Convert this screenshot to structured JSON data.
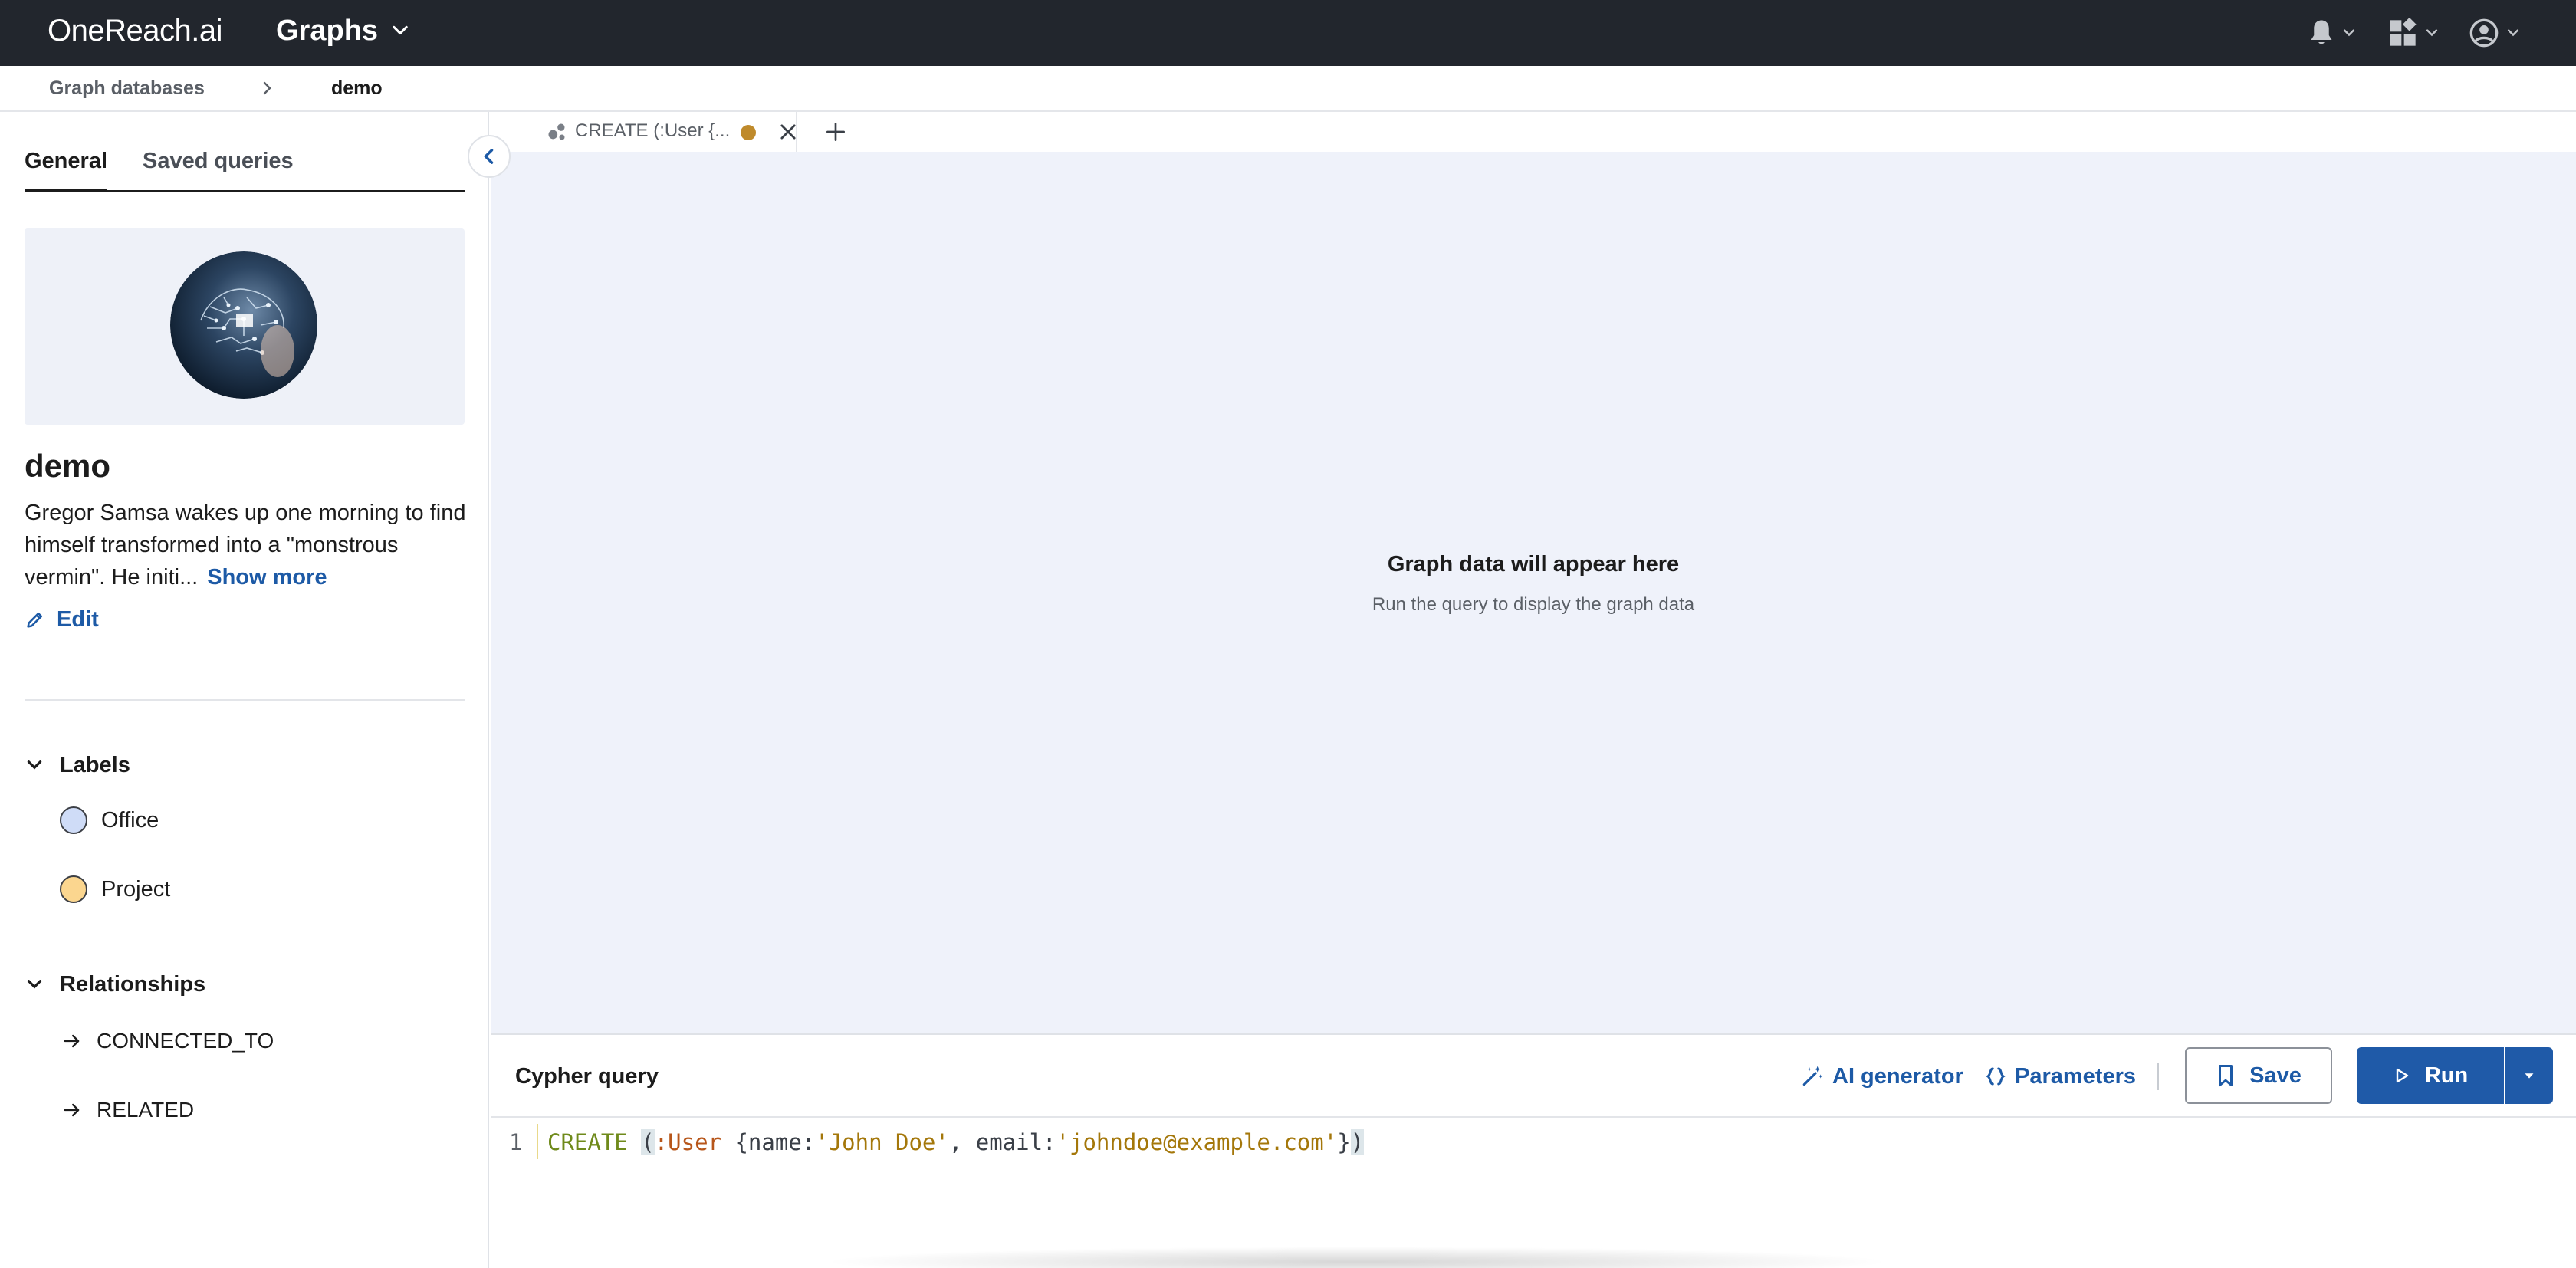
{
  "topbar": {
    "logo": "OneReach.ai",
    "app_title": "Graphs"
  },
  "breadcrumb": {
    "root": "Graph databases",
    "current": "demo"
  },
  "sidebar": {
    "tabs": [
      "General",
      "Saved queries"
    ],
    "db_name": "demo",
    "description": "Gregor Samsa wakes up one morning to find himself transformed into a \"monstrous vermin\". He initi...",
    "show_more": "Show more",
    "edit": "Edit",
    "labels_heading": "Labels",
    "labels": [
      {
        "name": "Office",
        "color": "#cfdcf7"
      },
      {
        "name": "Project",
        "color": "#fbd68f"
      }
    ],
    "relationships_heading": "Relationships",
    "relationships": [
      "CONNECTED_TO",
      "RELATED"
    ]
  },
  "query_tab": {
    "title": "CREATE (:User {...",
    "unsaved_color": "#bf8a2b"
  },
  "canvas": {
    "empty_title": "Graph data will appear here",
    "empty_subtitle": "Run the query to display the graph data"
  },
  "query_panel": {
    "title": "Cypher query",
    "ai_generator": "AI generator",
    "parameters": "Parameters",
    "save": "Save",
    "run": "Run",
    "line_number": "1",
    "code": {
      "keyword": "CREATE",
      "open_paren": "(",
      "label": ":User",
      "part1": " {name:",
      "name_value": "'John Doe'",
      "part2": ", email:",
      "email_value": "'johndoe@example.com'",
      "part3": "}",
      "close_paren": ")"
    }
  },
  "colors": {
    "topbar_bg": "#22262d",
    "accent_blue": "#1f5aa8",
    "canvas_bg": "#eff2fa"
  }
}
